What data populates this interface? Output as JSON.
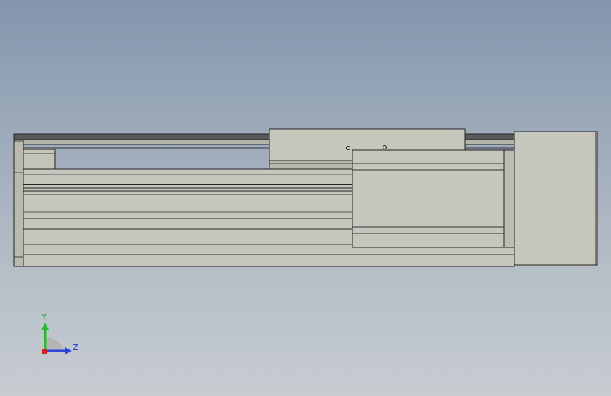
{
  "viewport": {
    "background_top": "#8496ad",
    "background_bottom": "#c7ccd1"
  },
  "model": {
    "body_color": "#c6c6bc",
    "edge_color": "#2a2a2a",
    "shadow_color": "#9c9c94"
  },
  "triad": {
    "y_label": "Y",
    "z_label": "Z",
    "y_color": "#1fbf2a",
    "z_color": "#2a45d8",
    "x_color": "#d81e1e"
  }
}
